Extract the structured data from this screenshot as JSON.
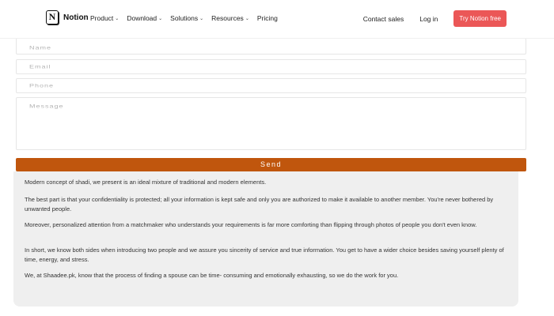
{
  "navbar": {
    "brand": {
      "logo_letter": "N",
      "name": "Notion",
      "logo_icon": "notion-logo"
    },
    "links": [
      {
        "label": "Product",
        "has_dropdown": true
      },
      {
        "label": "Download",
        "has_dropdown": true
      },
      {
        "label": "Solutions",
        "has_dropdown": true
      },
      {
        "label": "Resources",
        "has_dropdown": true
      },
      {
        "label": "Pricing",
        "has_dropdown": false
      }
    ],
    "contact_sales": "Contact sales",
    "login": "Log in",
    "cta": "Try Notion free",
    "cta_color": "#eb5757"
  },
  "form": {
    "name_placeholder": "Name",
    "email_placeholder": "Email",
    "phone_placeholder": "Phone",
    "message_placeholder": "Message",
    "send_label": "Send",
    "send_color": "#c0560d"
  },
  "content": {
    "paragraphs": [
      "Modern concept of shadi, we present is an ideal mixture of traditional and modern elements.",
      "The best part is that your confidentiality is protected; all your information is kept safe and only you are authorized to make it available to another member. You're never bothered by unwanted people.",
      "Moreover, personalized attention from a matchmaker who understands your requirements is far more comforting than flipping through photos of people you don't even know.",
      "In short, we know both sides when introducing two people and we assure you sincerity of service and true information. You get to have a wider choice besides saving yourself plenty of time, energy, and stress.",
      "We, at Shaadee.pk, know that the process of finding a spouse can be time- consuming and emotionally exhausting, so we do the work for you."
    ]
  }
}
